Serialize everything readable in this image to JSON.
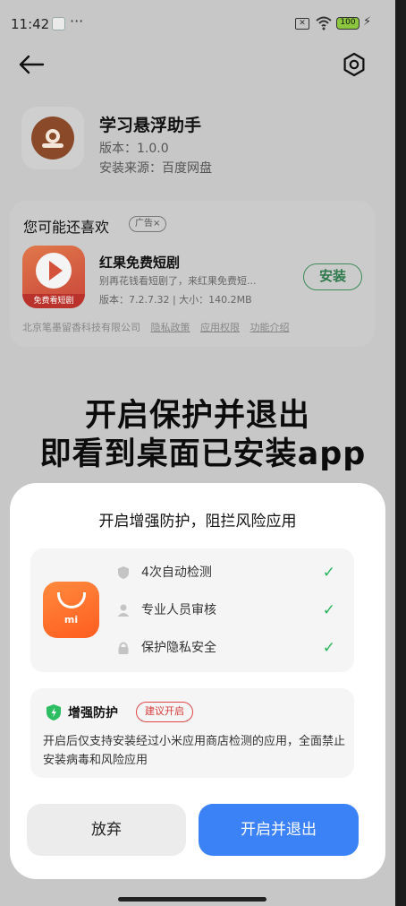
{
  "status_bar": {
    "time": "11:42",
    "dots": "···",
    "battery": "100",
    "sim_icon": "sim-x-icon",
    "wifi_icon": "wifi-icon"
  },
  "header": {
    "back_icon": "back-arrow-icon",
    "settings_icon": "settings-icon"
  },
  "app": {
    "name": "学习悬浮助手",
    "version": "版本：1.0.0",
    "source": "安装来源：百度网盘"
  },
  "recommend": {
    "title": "您可能还喜欢",
    "ad_tag": "广告×",
    "item": {
      "name": "红果免费短剧",
      "icon_caption": "免费看短剧",
      "description": "别再花钱看短剧了，来红果免费短...",
      "meta": "版本：7.2.7.32 | 大小：140.2MB",
      "install_label": "安装"
    },
    "footer": {
      "company": "北京笔墨留香科技有限公司",
      "links": [
        "隐私政策",
        "应用权限",
        "功能介绍"
      ]
    }
  },
  "overlay": {
    "line1": "开启保护并退出",
    "line2": "即看到桌面已安装app"
  },
  "sheet": {
    "title": "开启增强防护，阻拦风险应用",
    "mi_label": "mi",
    "features": [
      {
        "label": "4次自动检测",
        "icon": "shield-icon"
      },
      {
        "label": "专业人员审核",
        "icon": "person-icon"
      },
      {
        "label": "保护隐私安全",
        "icon": "lock-icon"
      }
    ],
    "check_mark": "✓",
    "protect": {
      "title": "增强防护",
      "tag": "建议开启",
      "description": "开启后仅支持安装经过小米应用商店检测的应用，全面禁止安装病毒和风险应用"
    },
    "buttons": {
      "give_up": "放弃",
      "enable_exit": "开启并退出"
    }
  },
  "colors": {
    "primary": "#3b82f6",
    "success": "#27b45a",
    "danger": "#e04848",
    "install": "#2e7a4c"
  }
}
